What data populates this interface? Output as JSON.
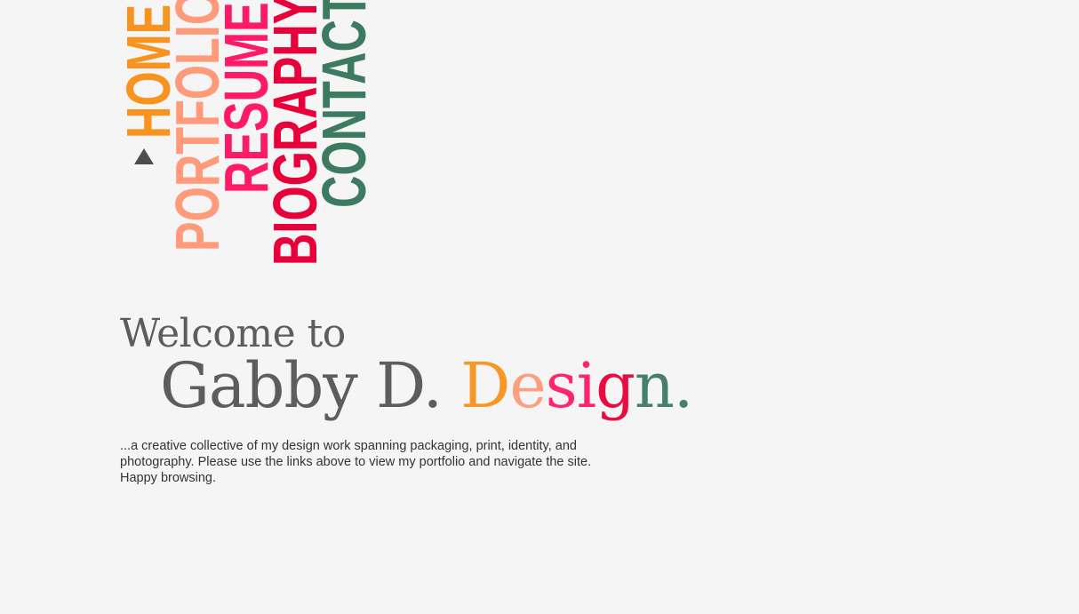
{
  "nav": {
    "items": [
      {
        "label": "HOME",
        "color": "#f7931e"
      },
      {
        "label": "PORTFOLIO",
        "color": "#ff9a7a"
      },
      {
        "label": "RESUME",
        "color": "#ff1a66"
      },
      {
        "label": "BIOGRAPHY",
        "color": "#e8003a"
      },
      {
        "label": "CONTACT",
        "color": "#3d7a62"
      }
    ],
    "active": "HOME"
  },
  "hero": {
    "welcome": "Welcome to",
    "brand_name": "Gabby D.",
    "design_letters": [
      {
        "char": "D",
        "color": "#f7931e"
      },
      {
        "char": "e",
        "color": "#ff9a7a"
      },
      {
        "char": "s",
        "color": "#ff1a66"
      },
      {
        "char": "i",
        "color": "#ff1a66"
      },
      {
        "char": "g",
        "color": "#e8003a"
      },
      {
        "char": "n",
        "color": "#3d7a62"
      },
      {
        "char": ".",
        "color": "#3d7a62"
      }
    ]
  },
  "intro": {
    "text": "...a creative collective of my design work spanning packaging, print, identity, and photography. Please use the links above to view my portfolio and navigate the site. Happy browsing."
  },
  "colors": {
    "background": "#f5f5f5",
    "text": "#555555",
    "indicator": "#4d4d4d"
  }
}
